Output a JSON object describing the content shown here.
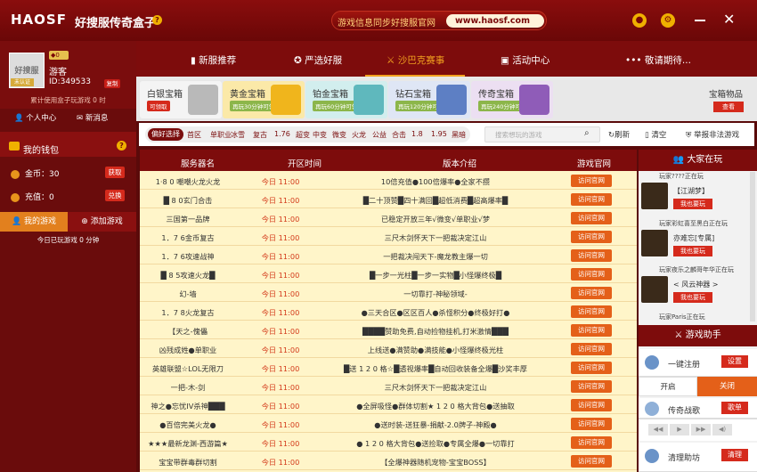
{
  "titlebar": {
    "logo": "HAOSF",
    "title": "好搜服传奇盒子",
    "banner_text": "游戏信息同步好搜服官网",
    "banner_url": "www.haosf.com"
  },
  "user": {
    "level": "◆0",
    "avatar_text": "好搜服",
    "avatar_badge": "未认证",
    "name": "游客",
    "id": "ID:349533",
    "copy": "复制",
    "usage": "累计使用盒子玩游戏 0 时",
    "center": "个人中心",
    "messages": "新消息"
  },
  "wallet": {
    "title": "我的钱包",
    "gold_label": "金币：",
    "gold": "30",
    "gold_btn": "获取",
    "charge_label": "充值：",
    "charge": "0",
    "charge_btn": "兑换"
  },
  "games": {
    "my": "我的游戏",
    "add": "添加游戏",
    "played": "今日已玩游戏 0 分钟"
  },
  "nav": [
    "新服推荐",
    "严选好服",
    "沙巴克赛事",
    "活动中心",
    "敬请期待..."
  ],
  "chests": [
    {
      "name": "白银宝箱",
      "sub": "可领取",
      "bg": "#f4f4f4",
      "sub_bg": "#d52a1c",
      "img": "#b9b9b9"
    },
    {
      "name": "黄金宝箱",
      "sub": "再玩30分钟可领取",
      "bg": "#fbe9a8",
      "sub_bg": "#8cb64a",
      "img": "#f0b51c"
    },
    {
      "name": "铂金宝箱",
      "sub": "再玩60分钟可领取",
      "bg": "#d2eeee",
      "sub_bg": "#8cb64a",
      "img": "#5fb8bd"
    },
    {
      "name": "钻石宝箱",
      "sub": "再玩120分钟可领取",
      "bg": "#dfe6f5",
      "sub_bg": "#8cb64a",
      "img": "#5d7fc4"
    },
    {
      "name": "传奇宝箱",
      "sub": "再玩240分钟可领取",
      "bg": "#ecdff2",
      "sub_bg": "#8cb64a",
      "img": "#8f5cb8"
    }
  ],
  "treasure": {
    "title": "宝箱物品",
    "btn": "查看"
  },
  "filter": {
    "active": "偏好选择",
    "items": [
      "首区",
      "单职业",
      "冰雪",
      "复古",
      "1.76",
      "超变",
      "中变",
      "微变",
      "火龙",
      "公益",
      "合击",
      "1.8",
      "1.95",
      "黑暗"
    ],
    "search_placeholder": "搜索想玩的游戏",
    "refresh": "刷新",
    "clear": "清空",
    "report": "举报非法游戏"
  },
  "table": {
    "headers": [
      "服务器名",
      "开区时间",
      "版本介绍",
      "游戏官网"
    ],
    "visit": "访问官网",
    "rows": [
      {
        "name": "1·8 0 嘲嘲火龙火龙",
        "time": "今日 11:00",
        "intro": "10倍充值●100倍爆率●全家不攒"
      },
      {
        "name": "█ 8 0玄门合击",
        "time": "今日 11:00",
        "intro": "█二十顶赞█四十满回█超低消费█超高爆率█"
      },
      {
        "name": "三国第一品牌",
        "time": "今日 11:00",
        "intro": "已稳定开放三年√微变√单职业√梦"
      },
      {
        "name": "1．7 6金币复古",
        "time": "今日 11:00",
        "intro": "三尺木剑怀天下一把裁决定江山"
      },
      {
        "name": "1．7 6攻速战神",
        "time": "今日 11:00",
        "intro": "一把裁决闯天下-魔龙教主爆一切"
      },
      {
        "name": "█ 8 5攻速火龙█",
        "time": "今日 11:00",
        "intro": "█一步一光柱█一步一实物█小怪爆终极█"
      },
      {
        "name": "幻-墙",
        "time": "今日 11:00",
        "intro": "一切靠打-神秘领域-"
      },
      {
        "name": "1．7 8火龙复古",
        "time": "今日 11:00",
        "intro": "●三天合区●区区百人●杀怪积分●终极好打●"
      },
      {
        "name": "【天之-傀儡",
        "time": "今日 11:00",
        "intro": "████赞助免费,自动捡物挂机,打米激情███"
      },
      {
        "name": "凶残成姓●单职业",
        "time": "今日 11:00",
        "intro": "上线送●满赞助●满技能●小怪爆终极光柱"
      },
      {
        "name": "英雄联盟☆LOL无限刀",
        "time": "今日 11:00",
        "intro": "█送 1 2 0 格☆█透视爆率█自动回收装备全爆█沙奖丰厚"
      },
      {
        "name": "一把-木-剑",
        "time": "今日 11:00",
        "intro": "三尺木剑怀天下一把裁决定江山"
      },
      {
        "name": "神之●忘忧IV杀神███",
        "time": "今日 11:00",
        "intro": "●全屏吸怪●群体切割★ 1 2 0 格大背包●送抽取"
      },
      {
        "name": "●百倍完美火龙●",
        "time": "今日 11:00",
        "intro": "●送时装-送狂暴-捐献-2.0牌子-神殿●"
      },
      {
        "name": "★★★最新龙渊-西游篇★",
        "time": "今日 11:00",
        "intro": "● 1 2 0 格大背包●送捡取●专属全爆●一切靠打"
      },
      {
        "name": "宝宝带群毒群切割",
        "time": "今日 11:00",
        "intro": "【全爆神器随机宠物-宝宝BOSS】"
      }
    ]
  },
  "playing": {
    "title": "大家在玩",
    "entries": [
      {
        "who": "玩家????正在玩",
        "game": "【江湖梦】",
        "btn": "我也要玩"
      },
      {
        "who": "玩家彩虹喜至黑白正在玩",
        "game": "亦难忘[专属]",
        "btn": "我也要玩"
      },
      {
        "who": "玩家夜乐之麟哥年华正在玩",
        "game": "< 风云神器 >",
        "btn": "我也要玩"
      },
      {
        "who": "玩家Paris正在玩",
        "game": "",
        "btn": ""
      }
    ]
  },
  "assistant": {
    "title": "游戏助手",
    "login": "一键注册",
    "login_btn": "设置",
    "on": "开启",
    "off": "关闭",
    "song": "传奇战歌",
    "song_btn": "歌单",
    "clean": "清理助坊",
    "clean_btn": "清理"
  }
}
